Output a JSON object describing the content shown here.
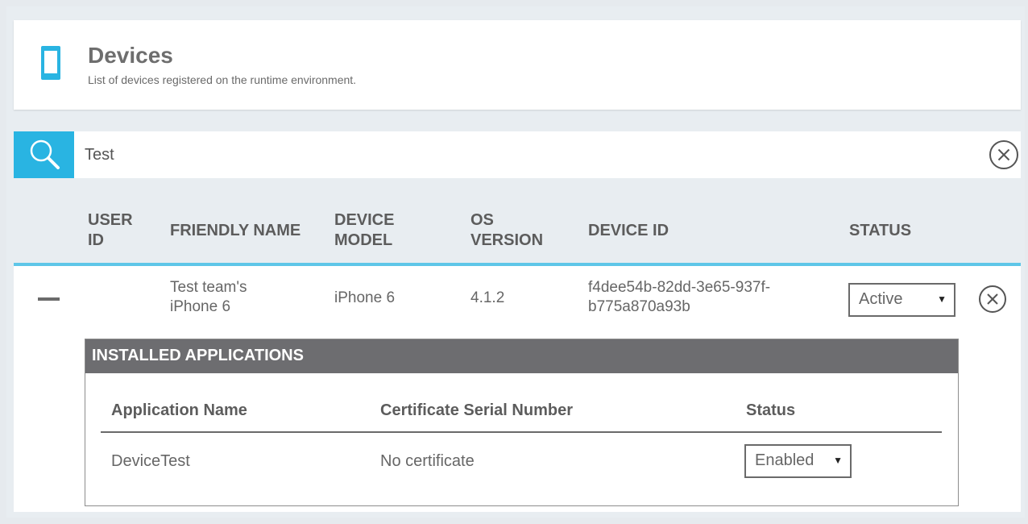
{
  "header": {
    "title": "Devices",
    "subtitle": "List of devices registered on the runtime environment.",
    "icon": "mobile-device-icon",
    "accent_color": "#29b4e2"
  },
  "search": {
    "value": "Test",
    "icon": "search-icon",
    "clear_icon": "close-circle-icon"
  },
  "table": {
    "columns": [
      "USER ID",
      "FRIENDLY NAME",
      "DEVICE MODEL",
      "OS VERSION",
      "DEVICE ID",
      "STATUS"
    ],
    "rows": [
      {
        "user_id": "",
        "friendly_name": "Test team's iPhone 6",
        "device_model": "iPhone 6",
        "os_version": "4.1.2",
        "device_id": "f4dee54b-82dd-3e65-937f-b775a870a93b",
        "status": "Active",
        "expanded": true,
        "installed_applications": {
          "title": "INSTALLED APPLICATIONS",
          "columns": [
            "Application Name",
            "Certificate Serial Number",
            "Status"
          ],
          "rows": [
            {
              "application_name": "DeviceTest",
              "certificate_serial_number": "No certificate",
              "status": "Enabled"
            }
          ]
        }
      }
    ]
  }
}
